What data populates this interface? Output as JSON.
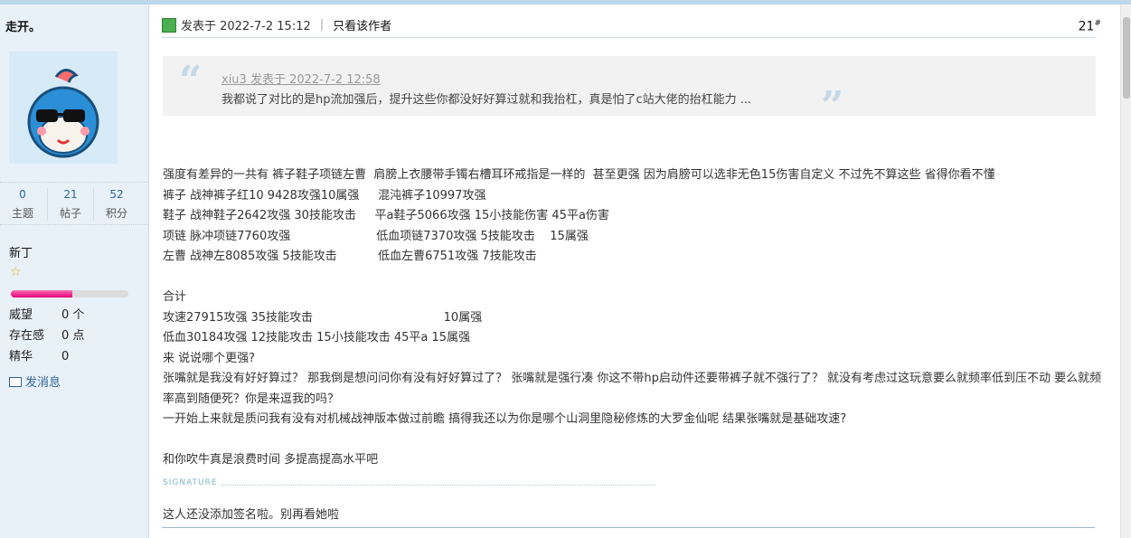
{
  "user": {
    "name": "走开。",
    "stats": [
      {
        "value": "0",
        "label": "主题"
      },
      {
        "value": "21",
        "label": "帖子"
      },
      {
        "value": "52",
        "label": "积分"
      }
    ],
    "rank": "新丁",
    "progress": 0.52,
    "attrs": [
      {
        "key": "威望",
        "value": "0 个"
      },
      {
        "key": "存在感",
        "value": "0 点"
      },
      {
        "key": "精华",
        "value": "0"
      }
    ],
    "message_label": "发消息"
  },
  "post": {
    "posted_label": "发表于 2022-7-2 15:12",
    "separator": "|",
    "author_only": "只看该作者",
    "floor": "21",
    "floor_sup": "#",
    "quote": {
      "meta": "xiu3 发表于 2022-7-2 12:58",
      "text": "我都说了对比的是hp流加强后，提升这些你都没好好算过就和我抬杠，真是怕了c站大佬的抬杠能力 ..."
    },
    "body_lines": [
      "强度有差异的一共有 裤子鞋子项链左曹  肩膀上衣腰带手镯右槽耳环戒指是一样的  甚至更强 因为肩膀可以选非无色15伤害自定义 不过先不算这些 省得你看不懂",
      "裤子 战神裤子红10 9428攻强10属强     混沌裤子10997攻强",
      "鞋子 战神鞋子2642攻强 30技能攻击     平a鞋子5066攻强 15小技能伤害 45平a伤害",
      "项链 脉冲项链7760攻强                       低血项链7370攻强 5技能攻击    15属强",
      "左曹 战神左8085攻强 5技能攻击           低血左曹6751攻强 7技能攻击",
      "",
      "合计",
      "攻速27915攻强 35技能攻击                                   10属强",
      "低血30184攻强 12技能攻击 15小技能攻击 45平a 15属强",
      "来 说说哪个更强?",
      "张嘴就是我没有好好算过？ 那我倒是想问问你有没有好好算过了？  张嘴就是强行凑 你这不带hp启动件还要带裤子就不强行了？  就没有考虑过这玩意要么就频率低到压不动 要么就频率高到随便死？你是来逗我的吗？",
      "一开始上来就是质问我有没有对机械战神版本做过前瞻 搞得我还以为你是哪个山洞里隐秘修炼的大罗金仙呢 结果张嘴就是基础攻速?",
      "",
      "和你吹牛真是浪费时间 多提高提高水平吧"
    ],
    "signature_label": "SIGNATURE",
    "signature_text": "这人还没添加签名啦。别再看她啦"
  },
  "colors": {
    "sidebar_bg": "#e8f0f8",
    "link": "#336699",
    "progress_fill": "#e6007a"
  }
}
